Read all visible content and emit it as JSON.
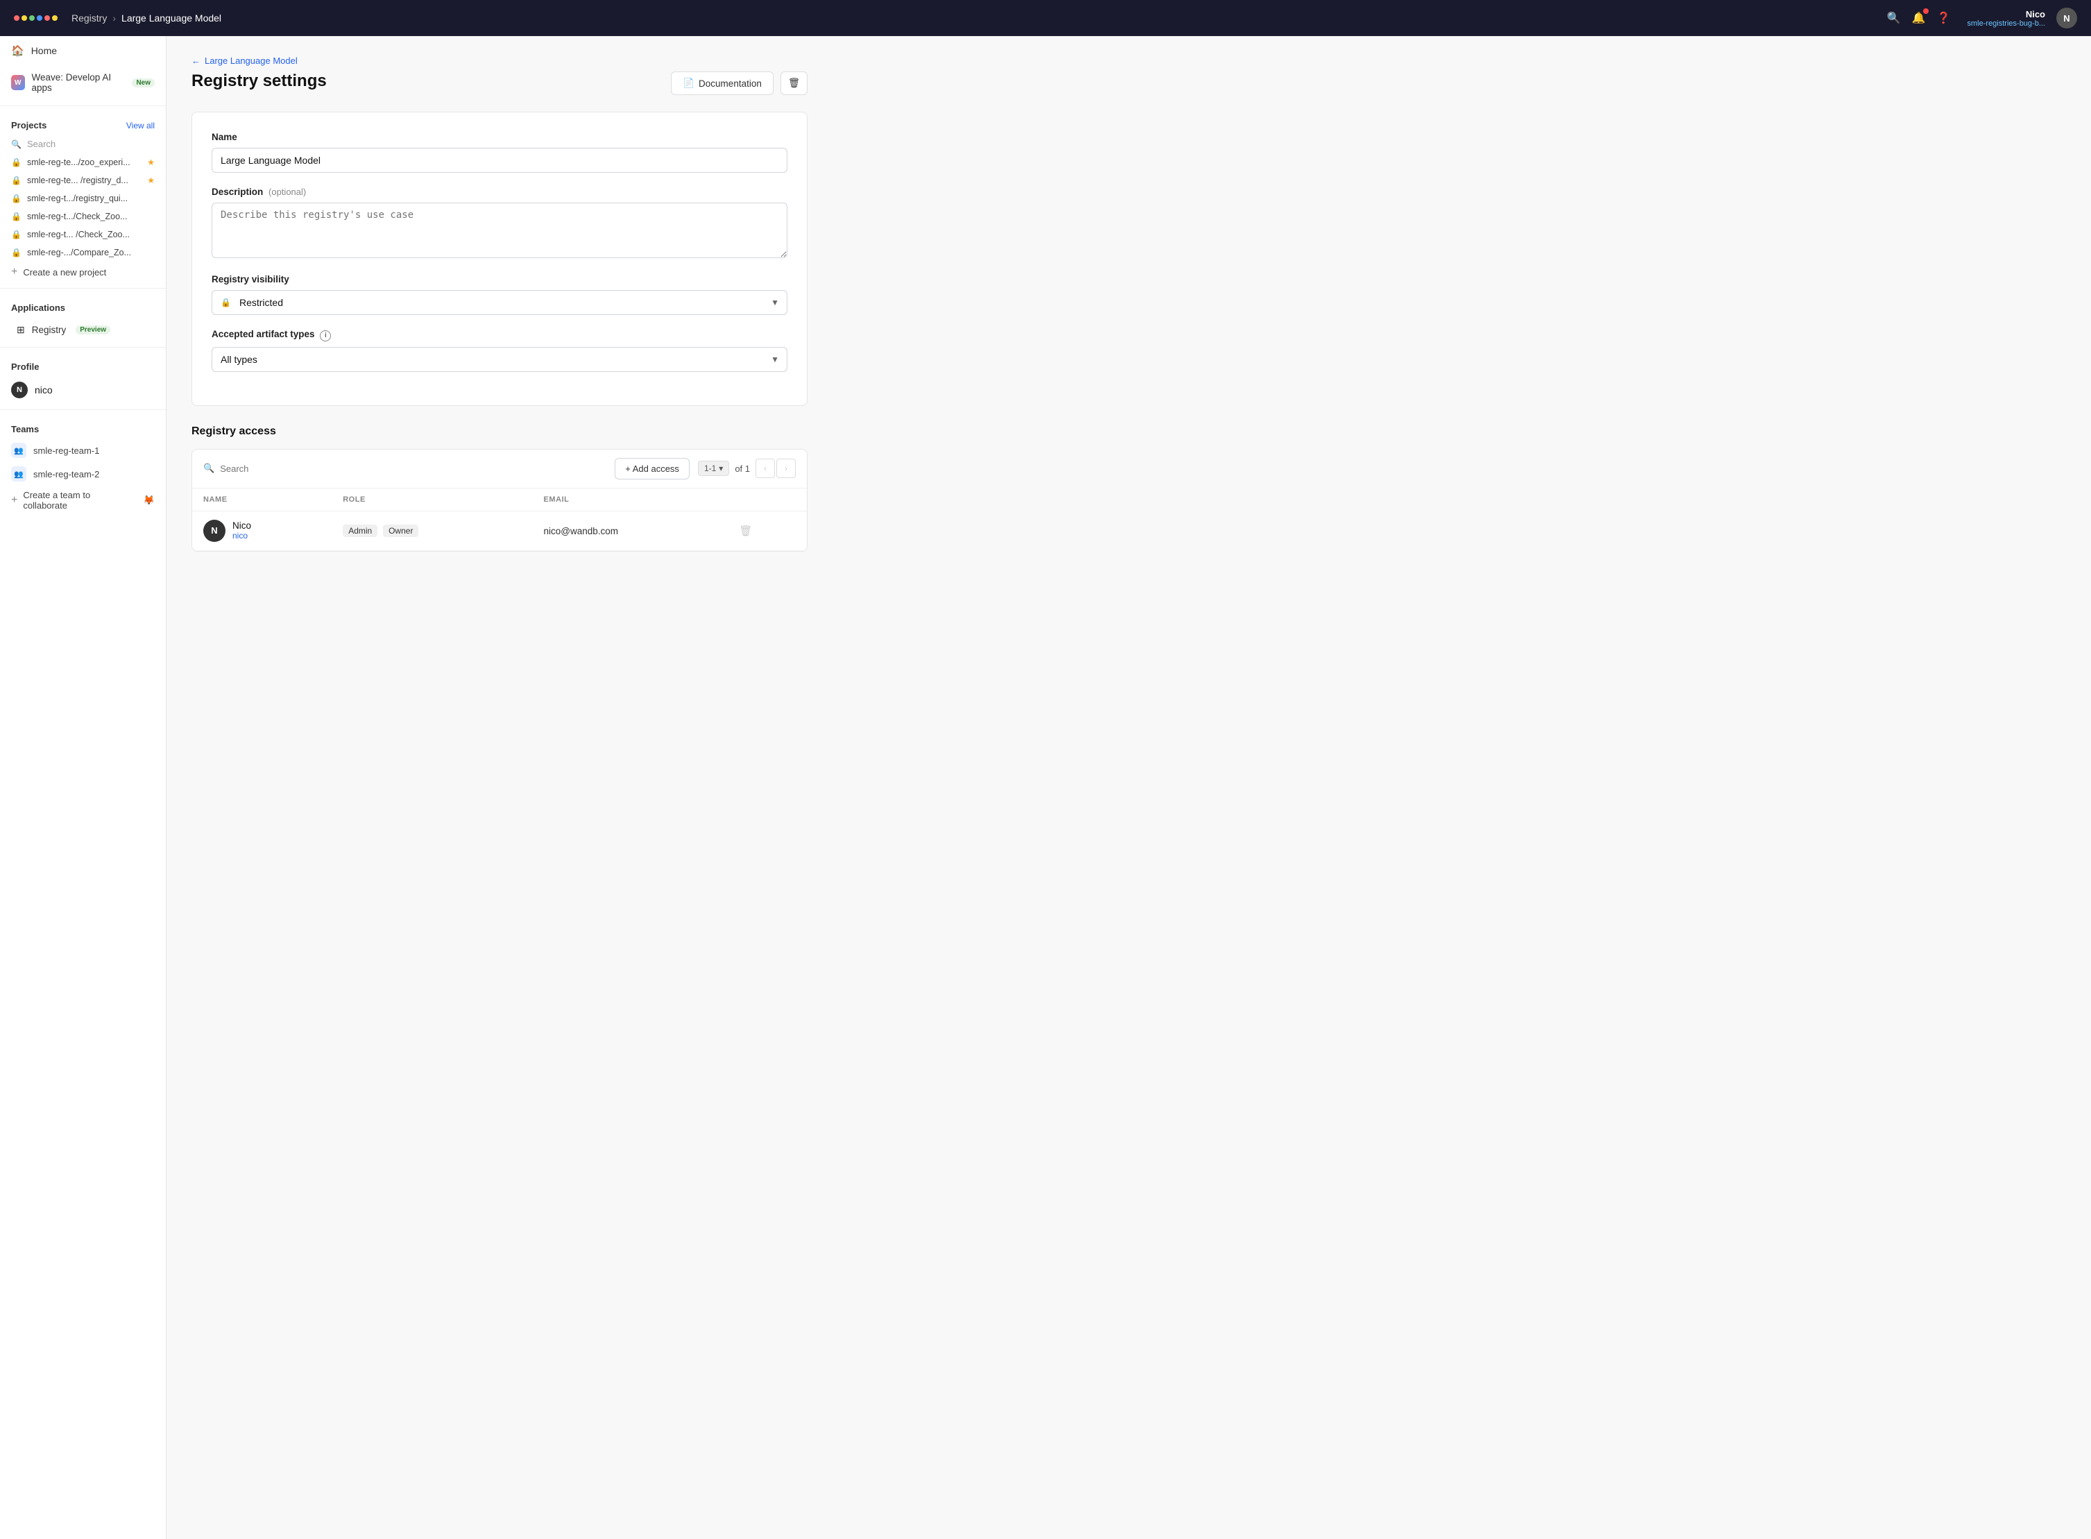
{
  "topnav": {
    "breadcrumb_parent": "Registry",
    "breadcrumb_current": "Large Language Model",
    "user_name": "Nico",
    "user_org": "smle-registries-bug-b...",
    "user_initial": "N"
  },
  "sidebar": {
    "home_label": "Home",
    "weave_label": "Weave: Develop AI apps",
    "weave_badge": "New",
    "projects_label": "Projects",
    "projects_view_all": "View all",
    "search_placeholder": "Search",
    "projects": [
      {
        "name": "smle-reg-te.../zoo_experi...",
        "starred": true
      },
      {
        "name": "smle-reg-te... /registry_d...",
        "starred": true
      },
      {
        "name": "smle-reg-t.../registry_qui...",
        "starred": false
      },
      {
        "name": "smle-reg-t.../Check_Zoo...",
        "starred": false
      },
      {
        "name": "smle-reg-t... /Check_Zoo...",
        "starred": false
      },
      {
        "name": "smle-reg-.../Compare_Zo...",
        "starred": false
      }
    ],
    "create_project_label": "Create a new project",
    "applications_label": "Applications",
    "registry_label": "Registry",
    "registry_badge": "Preview",
    "profile_label": "Profile",
    "profile_user": "nico",
    "teams_label": "Teams",
    "teams": [
      {
        "name": "smle-reg-team-1"
      },
      {
        "name": "smle-reg-team-2"
      }
    ],
    "create_team_label": "Create a team to collaborate"
  },
  "main": {
    "back_label": "Large Language Model",
    "page_title": "Registry settings",
    "doc_button": "Documentation",
    "form": {
      "name_label": "Name",
      "name_value": "Large Language Model",
      "description_label": "Description",
      "description_optional": "(optional)",
      "description_placeholder": "Describe this registry's use case",
      "visibility_label": "Registry visibility",
      "visibility_value": "Restricted",
      "artifacts_label": "Accepted artifact types",
      "artifacts_info": "i",
      "artifacts_value": "All types"
    },
    "access_section": {
      "heading": "Registry access",
      "search_placeholder": "Search",
      "add_button": "+ Add access",
      "pagination_range": "1-1",
      "pagination_of": "of 1",
      "table_headers": [
        "NAME",
        "ROLE",
        "EMAIL"
      ],
      "rows": [
        {
          "initial": "N",
          "name": "Nico",
          "handle": "nico",
          "role": "Admin",
          "role2": "Owner",
          "email": "nico@wandb.com"
        }
      ]
    }
  }
}
